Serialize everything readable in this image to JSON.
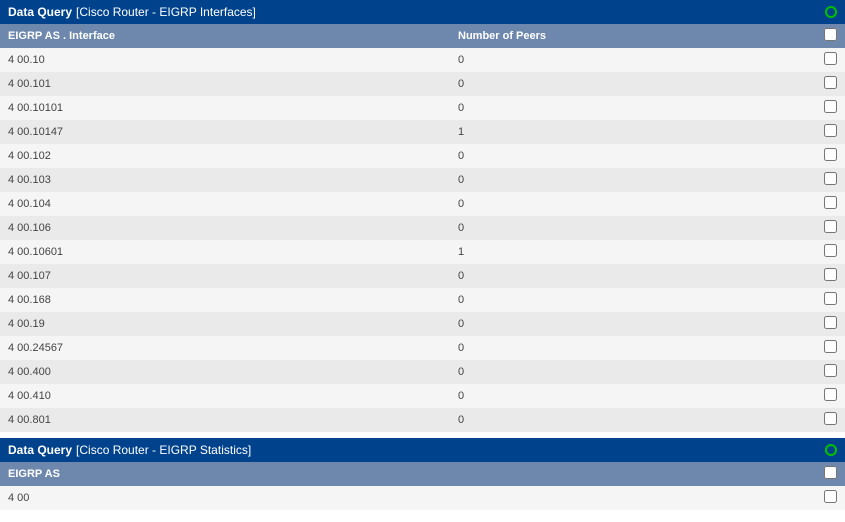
{
  "panel1": {
    "title_prefix": "Data Query",
    "title_bracket": "[Cisco Router - EIGRP Interfaces]",
    "header": {
      "col_interface": "EIGRP AS . Interface",
      "col_peers": "Number of Peers"
    },
    "rows": [
      {
        "iface": "4 00.10",
        "peers": "0"
      },
      {
        "iface": "4 00.101",
        "peers": "0"
      },
      {
        "iface": "4 00.10101",
        "peers": "0"
      },
      {
        "iface": "4 00.10147",
        "peers": "1"
      },
      {
        "iface": "4 00.102",
        "peers": "0"
      },
      {
        "iface": "4 00.103",
        "peers": "0"
      },
      {
        "iface": "4 00.104",
        "peers": "0"
      },
      {
        "iface": "4 00.106",
        "peers": "0"
      },
      {
        "iface": "4 00.10601",
        "peers": "1"
      },
      {
        "iface": "4 00.107",
        "peers": "0"
      },
      {
        "iface": "4 00.168",
        "peers": "0"
      },
      {
        "iface": "4 00.19",
        "peers": "0"
      },
      {
        "iface": "4 00.24567",
        "peers": "0"
      },
      {
        "iface": "4 00.400",
        "peers": "0"
      },
      {
        "iface": "4 00.410",
        "peers": "0"
      },
      {
        "iface": "4 00.801",
        "peers": "0"
      }
    ]
  },
  "panel2": {
    "title_prefix": "Data Query",
    "title_bracket": "[Cisco Router - EIGRP Statistics]",
    "header": {
      "col_as": "EIGRP AS"
    },
    "rows": [
      {
        "as": "4 00"
      }
    ]
  }
}
